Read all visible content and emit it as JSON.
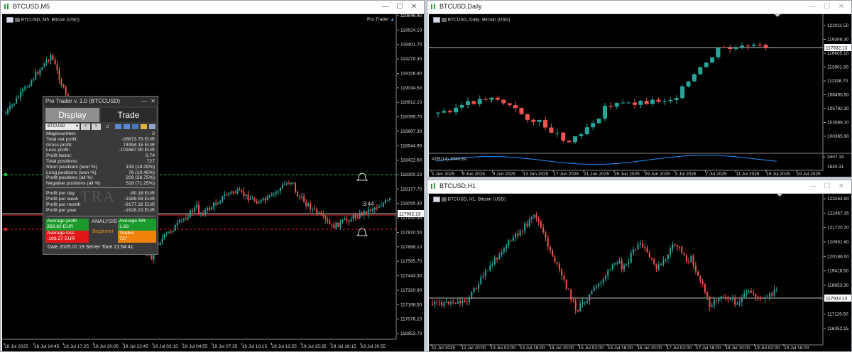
{
  "left_window": {
    "title": "BTCUSD,M5",
    "chart_label": "BTCUSD, M5:  Bitcoin (USD)",
    "ea_label": "Pro Trader",
    "timer": "3:44",
    "price_tag": "117932.13",
    "price_axis": [
      "119646.45",
      "119524.10",
      "119401.70",
      "119279.30",
      "119156.90",
      "119034.50",
      "118912.10",
      "118789.70",
      "118667.30",
      "118544.90",
      "118422.50",
      "118300.10",
      "118177.70",
      "118055.30",
      "117932.90",
      "117810.50",
      "117688.10",
      "117565.70",
      "117443.30",
      "117320.90",
      "117198.50",
      "117076.10",
      "116953.70"
    ],
    "time_axis": [
      "18 Jul 2025",
      "18 Jul 14:45",
      "18 Jul 17:25",
      "18 Jul 20:05",
      "18 Jul 22:45",
      "19 Jul 02:15",
      "19 Jul 04:55",
      "19 Jul 07:35",
      "19 Jul 10:15",
      "19 Jul 12:55",
      "19 Jul 15:35",
      "19 Jul 18:15",
      "19 Jul 20:55"
    ]
  },
  "daily_window": {
    "title": "BTCUSD,Daily",
    "chart_label": "BTCUSD, Daily:  Bitcoin (USD)",
    "price_tag": "117932.13",
    "price_axis": [
      "122011.50",
      "119308.30",
      "116605.10",
      "113901.90",
      "111198.70",
      "108495.50",
      "105792.30",
      "103089.10",
      "100385.90"
    ],
    "atr_label": "ATR(14) 3040.60",
    "atr_axis": [
      "3407.19",
      "1840.31"
    ],
    "time_axis": [
      "1 Jun 2025",
      "5 Jun 2025",
      "9 Jun 2025",
      "13 Jun 2025",
      "17 Jun 2025",
      "21 Jun 2025",
      "25 Jun 2025",
      "29 Jun 2025",
      "3 Jul 2025",
      "7 Jul 2025",
      "11 Jul 2025",
      "15 Jul 2025",
      "19 Jul 2025"
    ]
  },
  "h1_window": {
    "title": "BTCUSD,H1",
    "chart_label": "BTCUSD, H1:  Bitcoin (USD)",
    "price_tag": "117932.13",
    "price_axis": [
      "123254.90",
      "122467.35",
      "121720.20",
      "120951.60",
      "120186.00",
      "119418.50",
      "118653.30",
      "117885.70",
      "117119.50",
      "116352.15"
    ],
    "time_axis": [
      "11 Jul 2025",
      "12 Jul 10:00",
      "13 Jul 02:00",
      "13 Jul 18:00",
      "14 Jul 10:00",
      "15 Jul 02:00",
      "15 Jul 18:00",
      "16 Jul 10:00",
      "17 Jul 02:00",
      "17 Jul 18:00",
      "18 Jul 10:00",
      "19 Jul 02:00",
      "19 Jul 18:00"
    ]
  },
  "pro_trader": {
    "title": "Pro Trader v. 1.0 (BTCCUSD)",
    "tab_display": "Display",
    "tab_trade": "Trade",
    "symbol": "BTCUSD",
    "rows": [
      {
        "k": "Magicnumber:",
        "v": "2"
      },
      {
        "k": "Total net profit:",
        "v": "-26673.75 EUR"
      },
      {
        "k": "Gross profit:",
        "v": "74994.15 EUR"
      },
      {
        "k": "Loss profit:",
        "v": "-101667.90 EUR"
      },
      {
        "k": "Profit factor:",
        "v": "0.74"
      },
      {
        "k": "Total positions:",
        "v": "727"
      },
      {
        "k": "Short positions  (won %)",
        "v": "133 (18.29%)"
      },
      {
        "k": "Long positions  (won %)",
        "v": "76 (10.45%)"
      },
      {
        "k": "Profit positions (all %)",
        "v": "209 (28.75%)"
      },
      {
        "k": "Negative positions (all %)",
        "v": "518 (71.25%)"
      }
    ],
    "rows2": [
      {
        "k": "Profit per day",
        "v": "-90.18 EUR"
      },
      {
        "k": "Profit per week",
        "v": "-1589.59 EUR"
      },
      {
        "k": "Profit per month",
        "v": "-9177.32 EUR"
      },
      {
        "k": "Profit per year",
        "v": "-1626.23 EUR"
      }
    ],
    "avg_profit_label": "Average profit",
    "avg_profit_value": "358.82 EUR",
    "analysis_label": "ANALYSIS",
    "avg_rr_label": "Average RR",
    "avg_rr_value": "1.83",
    "avg_loss_label": "Average loss",
    "avg_loss_value": "-196.27 EUR",
    "level_label": "Beginner",
    "trades_label": "Trades",
    "trades_value": "727",
    "footer": "Date 2025.07.19 Server Time 21:54:41",
    "watermark": "TRA"
  }
}
